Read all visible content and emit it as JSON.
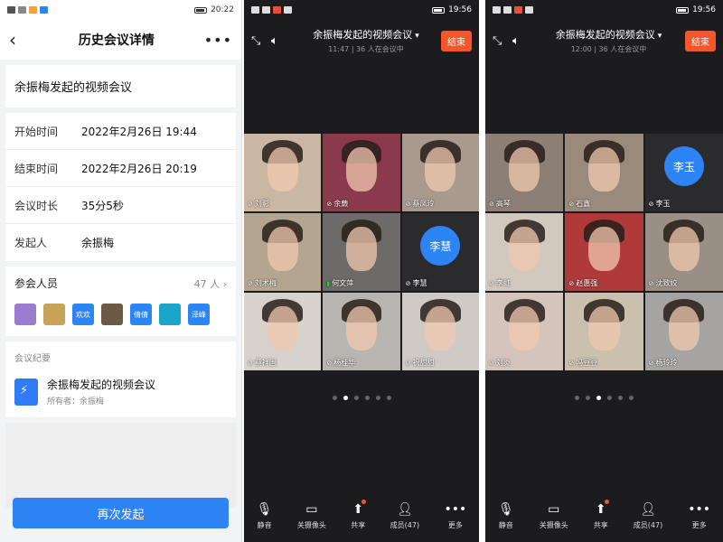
{
  "screen1": {
    "statusbar": {
      "time": "20:22"
    },
    "header": {
      "back_icon": "back-arrow-icon",
      "title": "历史会议详情",
      "more_icon": "more-icon"
    },
    "topic": "余振梅发起的视频会议",
    "details": [
      {
        "key": "开始时间",
        "value": "2022年2月26日 19:44"
      },
      {
        "key": "结束时间",
        "value": "2022年2月26日 20:19"
      },
      {
        "key": "会议时长",
        "value": "35分5秒"
      },
      {
        "key": "发起人",
        "value": "余振梅"
      }
    ],
    "participants": {
      "label": "参会人员",
      "count": "47 人",
      "avatars": [
        {
          "text": "",
          "color": "#9b7bd0"
        },
        {
          "text": "",
          "color": "#c8a35a"
        },
        {
          "text": "欢欢",
          "color": "#2d84f5"
        },
        {
          "text": "",
          "color": "#6b5a44"
        },
        {
          "text": "倩倩",
          "color": "#2d84f5"
        },
        {
          "text": "",
          "color": "#1aa6c9"
        },
        {
          "text": "泽峰",
          "color": "#2d84f5"
        }
      ]
    },
    "summary": {
      "label": "会议纪要",
      "doc_icon": "doc-icon",
      "title": "余振梅发起的视频会议",
      "owner": "所有者：余振梅"
    },
    "restart_button": "再次发起"
  },
  "meetings": [
    {
      "statusbar": {
        "time": "19:56"
      },
      "title": "余振梅发起的视频会议",
      "subtitle": "11:47 | 36 人在会议中",
      "end_button": "结束",
      "tiles": [
        {
          "name": "刘影",
          "avatar": "",
          "bg": "#c9b6a3",
          "mic_on": false
        },
        {
          "name": "余蕨",
          "avatar": "",
          "bg": "#8a3a4a",
          "mic_on": false
        },
        {
          "name": "蔡凤玲",
          "avatar": "",
          "bg": "#a89a8c",
          "mic_on": false
        },
        {
          "name": "刘术梅",
          "avatar": "",
          "bg": "#b4a590",
          "mic_on": false
        },
        {
          "name": "何文萍",
          "avatar": "",
          "bg": "#6d6a6a",
          "mic_on": true
        },
        {
          "name": "李慧",
          "avatar": "李慧",
          "bg": "#2b2b2d",
          "mic_on": false
        },
        {
          "name": "蔡祥国",
          "avatar": "",
          "bg": "#d8d2cc",
          "mic_on": false
        },
        {
          "name": "杨桂华",
          "avatar": "",
          "bg": "#b8b4b0",
          "mic_on": false
        },
        {
          "name": "祝甜甜",
          "avatar": "",
          "bg": "#cfcac6",
          "mic_on": false
        }
      ],
      "page_dots": 6,
      "active_dot": 1,
      "toolbar": [
        {
          "icon": "mic-icon",
          "label": "静音",
          "badge": false
        },
        {
          "icon": "camera-icon",
          "label": "关摄像头",
          "badge": false
        },
        {
          "icon": "share-screen-icon",
          "label": "共享",
          "badge": true
        },
        {
          "icon": "members-icon",
          "label": "成员(47)",
          "badge": false
        },
        {
          "icon": "more-icon",
          "label": "更多",
          "badge": false
        }
      ]
    },
    {
      "statusbar": {
        "time": "19:56"
      },
      "title": "余振梅发起的视频会议",
      "subtitle": "12:00 | 36 人在会议中",
      "end_button": "结束",
      "tiles": [
        {
          "name": "高琴",
          "avatar": "",
          "bg": "#8c7f76",
          "mic_on": false
        },
        {
          "name": "石鑫",
          "avatar": "",
          "bg": "#9a8a7c",
          "mic_on": false
        },
        {
          "name": "李玉",
          "avatar": "李玉",
          "bg": "#2b2b2d",
          "mic_on": false
        },
        {
          "name": "李虹",
          "avatar": "",
          "bg": "#d2c8be",
          "mic_on": false
        },
        {
          "name": "赵惠强",
          "avatar": "",
          "bg": "#b03a3a",
          "mic_on": false
        },
        {
          "name": "沈致姣",
          "avatar": "",
          "bg": "#9a8f85",
          "mic_on": false
        },
        {
          "name": "刘炎",
          "avatar": "",
          "bg": "#d4c4bc",
          "mic_on": false
        },
        {
          "name": "冯豆豆",
          "avatar": "",
          "bg": "#cbbfae",
          "mic_on": false
        },
        {
          "name": "杨玲玲",
          "avatar": "",
          "bg": "#a6a4a2",
          "mic_on": false
        }
      ],
      "page_dots": 6,
      "active_dot": 2,
      "toolbar": [
        {
          "icon": "mic-icon",
          "label": "静音",
          "badge": false
        },
        {
          "icon": "camera-icon",
          "label": "关摄像头",
          "badge": false
        },
        {
          "icon": "share-screen-icon",
          "label": "共享",
          "badge": true
        },
        {
          "icon": "members-icon",
          "label": "成员(47)",
          "badge": false
        },
        {
          "icon": "more-icon",
          "label": "更多",
          "badge": false
        }
      ]
    }
  ]
}
